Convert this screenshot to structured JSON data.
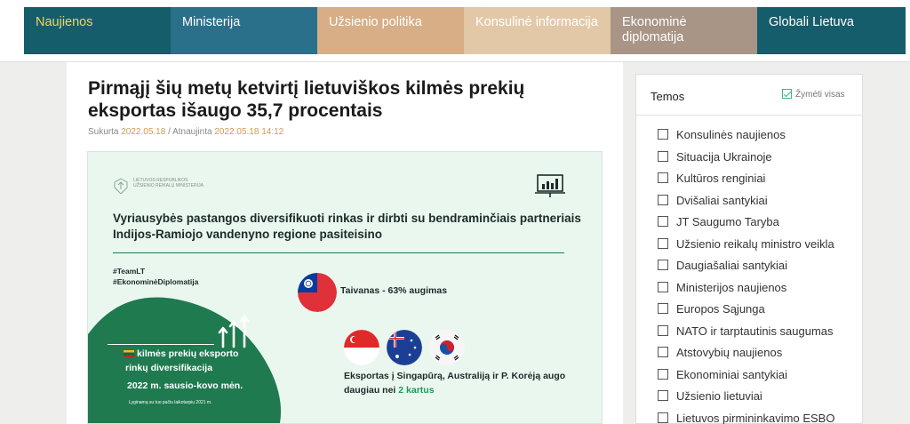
{
  "nav": {
    "items": [
      {
        "label": "Naujienos",
        "color": "#165d6b",
        "width": 165
      },
      {
        "label": "Ministerija",
        "color": "#2b708a",
        "width": 165
      },
      {
        "label": "Užsienio politika",
        "color": "#d7ae85",
        "width": 165
      },
      {
        "label": "Konsulinė informacija",
        "color": "#e3c8a8",
        "width": 165
      },
      {
        "label": "Ekonominė\ndiplomatija",
        "color": "#a89586",
        "width": 165
      },
      {
        "label": "Globali Lietuva",
        "color": "#165d6b",
        "width": 167
      }
    ],
    "active_index": 0
  },
  "article": {
    "title": "Pirmąjį šių metų ketvirtį lietuviškos kilmės prekių eksportas išaugo 35,7 procentais",
    "created_label": "Sukurta",
    "created_date": "2022.05.18",
    "separator": "/",
    "updated_label": "Atnaujinta",
    "updated_date": "2022.05.18 14:12"
  },
  "infographic": {
    "logo_text": "LIETUVOS RESPUBLIKOS UŽSIENIO REIKALŲ MINISTERIJA",
    "headline": "Vyriausybės pastangos diversifikuoti rinkas ir dirbti su bendraminčiais partneriais Indijos-Ramiojo vandenyno regione pasiteisino",
    "hashtag1": "#TeamLT",
    "hashtag2": "#EkonominėDiplomatija",
    "lt_line1": "kilmės prekių eksporto",
    "lt_line2": "rinkų diversifikacija",
    "lt_line3": "2022 m. sausio-kovo mėn.",
    "lt_note": "Lyginamą su tuo pačiu laikotarpiu 2021 m.",
    "taiwan_text": "Taivanas - 63% augimas",
    "export_text": "Eksportas į Singapūrą, Australiją ir P. Korėją augo daugiau nei",
    "export_highlight": "2 kartus",
    "accent_color": "#1f7a4f"
  },
  "sidebar": {
    "title": "Temos",
    "check_all": "Žymėti visas",
    "items": [
      "Konsulinės naujienos",
      "Situacija Ukrainoje",
      "Kultūros renginiai",
      "Dvišaliai santykiai",
      "JT Saugumo Taryba",
      "Užsienio reikalų ministro veikla",
      "Daugiašaliai santykiai",
      "Ministerijos naujienos",
      "Europos Sąjunga",
      "NATO ir tarptautinis saugumas",
      "Atstovybių naujienos",
      "Ekonominiai santykiai",
      "Užsienio lietuviai",
      "Lietuvos pirmininkavimo ESBO"
    ]
  }
}
